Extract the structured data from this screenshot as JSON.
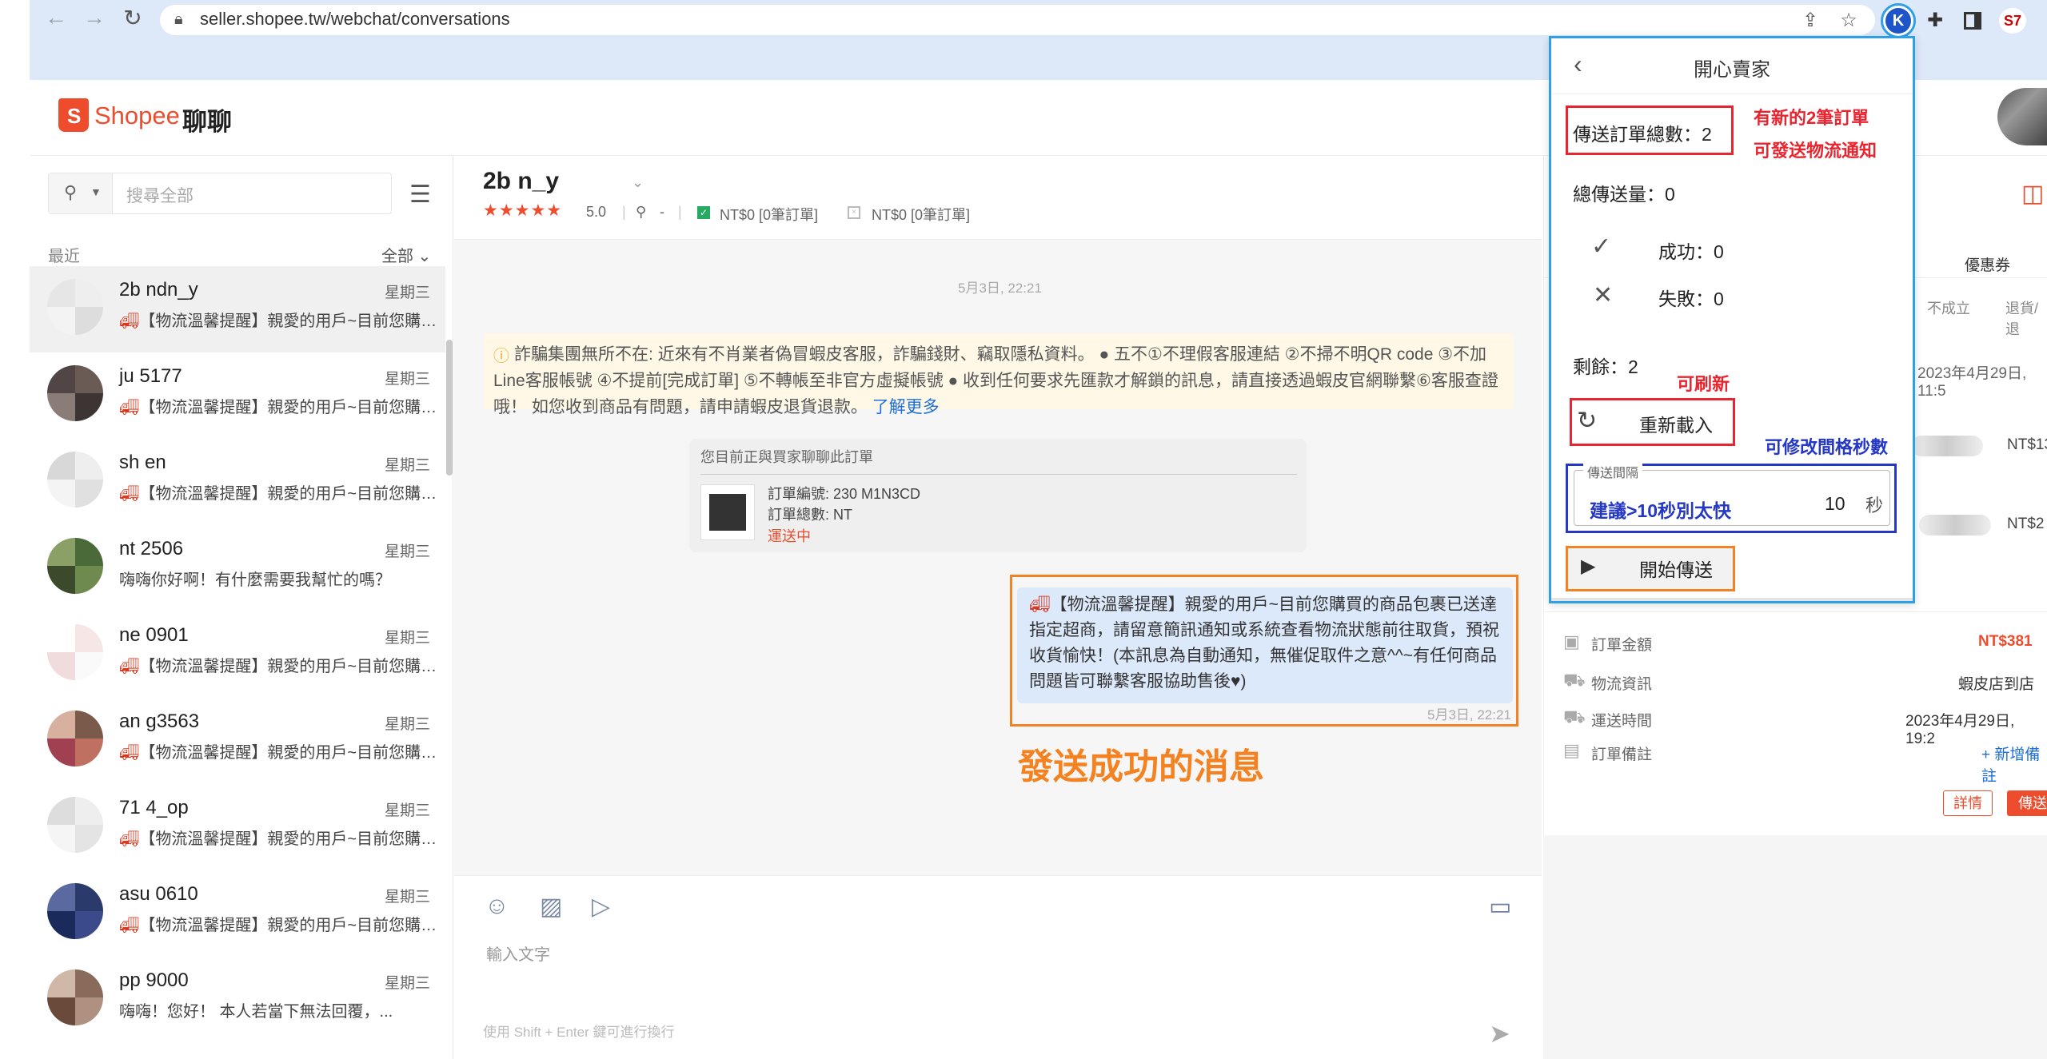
{
  "browser": {
    "url": "seller.shopee.tw/webchat/conversations",
    "ext_avatar": "K",
    "ext_badge": "S7"
  },
  "app": {
    "brand": "Shopee",
    "brand_sub": "聊聊"
  },
  "sidebar": {
    "search_placeholder": "搜尋全部",
    "recent_label": "最近",
    "filter_label": "全部",
    "conversations": [
      {
        "name": "2b   ndn_y",
        "day": "星期三",
        "preview": "【物流溫馨提醒】親愛的用戶~目前您購買的商品包裹已送達",
        "truck": true,
        "selected": true
      },
      {
        "name": "ju   5177",
        "day": "星期三",
        "preview": "【物流溫馨提醒】親愛的用戶~目前您購買的商品包裹已送達",
        "truck": true
      },
      {
        "name": "sh   en",
        "day": "星期三",
        "preview": "【物流溫馨提醒】親愛的用戶~目前您購買的商品包裹已送達",
        "truck": true
      },
      {
        "name": "nt   2506",
        "day": "星期三",
        "preview": "嗨嗨你好啊！有什麼需要我幫忙的嗎？",
        "truck": false
      },
      {
        "name": "ne   0901",
        "day": "星期三",
        "preview": "【物流溫馨提醒】親愛的用戶~目前您購買的商品包裹已送達",
        "truck": true
      },
      {
        "name": "an   g3563",
        "day": "星期三",
        "preview": "【物流溫馨提醒】親愛的用戶~目前您購買的商品包裹已送達",
        "truck": true
      },
      {
        "name": "71   4_op",
        "day": "星期三",
        "preview": "【物流溫馨提醒】親愛的用戶~目前您購買的商品包裹已送達",
        "truck": true
      },
      {
        "name": "asu   0610",
        "day": "星期三",
        "preview": "【物流溫馨提醒】親愛的用戶~目前您購買的商品包裹已送達",
        "truck": true
      },
      {
        "name": "pp   9000",
        "day": "星期三",
        "preview": "嗨嗨！您好！ 本人若當下無法回覆，...",
        "truck": false
      }
    ]
  },
  "chat": {
    "name": "2b   n_y",
    "stars": "★★★★★",
    "rating": "5.0",
    "location": "-",
    "meta1": "NT$0 [0筆訂單]",
    "meta2": "NT$0 [0筆訂單]",
    "date": "5月3日, 22:21",
    "warning": "詐騙集團無所不在: 近來有不肖業者偽冒蝦皮客服，詐騙錢財、竊取隱私資料。 ● 五不①不理假客服連結 ②不掃不明QR code ③不加Line客服帳號 ④不提前[完成訂單] ⑤不轉帳至非官方虛擬帳號 ● 收到任何要求先匯款才解鎖的訊息，請直接透過蝦皮官網聯繫⑥客服查證哦！ 如您收到商品有問題，請申請蝦皮退貨退款。",
    "warning_link": "了解更多",
    "order_card": {
      "title": "您目前正與買家聊聊此訂單",
      "order_no": "訂單編號: 230       M1N3CD",
      "order_total": "訂單總數: NT",
      "status": "運送中"
    },
    "message": "【物流溫馨提醒】親愛的用戶~目前您購買的商品包裹已送達指定超商，請留意簡訊通知或系統查看物流狀態前往取貨，預祝收貨愉快！(本訊息為自動通知，無催促取件之意^^~有任何商品問題皆可聯繫客服協助售後♥)",
    "message_time": "5月3日, 22:21",
    "annotation": "發送成功的消息",
    "input_placeholder": "輸入文字",
    "input_hint": "使用 Shift + Enter 鍵可進行換行"
  },
  "order_panel": {
    "tab_coupon": "優惠券",
    "tab_invalid": "不成立",
    "tab_return": "退貨/退",
    "date": "2023年4月29日, 11:5",
    "amount1": "NT$13",
    "amount2": "NT$2",
    "fields": [
      {
        "label": "訂單金額",
        "value": "NT$381"
      },
      {
        "label": "物流資訊",
        "value": "蝦皮店到店"
      },
      {
        "label": "運送時間",
        "value": "2023年4月29日, 19:2"
      },
      {
        "label": "訂單備註",
        "value": "+ 新增備註"
      }
    ],
    "detail_button": "詳情",
    "send_button": "傳送"
  },
  "popup": {
    "title": "開心賣家",
    "total": "傳送訂單總數：2",
    "sent": "總傳送量：0",
    "success": "成功：0",
    "fail": "失敗：0",
    "remain": "剩餘：2",
    "reload": "重新載入",
    "interval_legend": "傳送間隔",
    "interval_hint": "建議>10秒別太快",
    "interval_value": "10",
    "interval_unit": "秒",
    "start": "開始傳送",
    "anno_new_orders": "有新的2筆訂單",
    "anno_can_send": "可發送物流通知",
    "anno_refresh": "可刷新",
    "anno_interval": "可修改間格秒數"
  }
}
